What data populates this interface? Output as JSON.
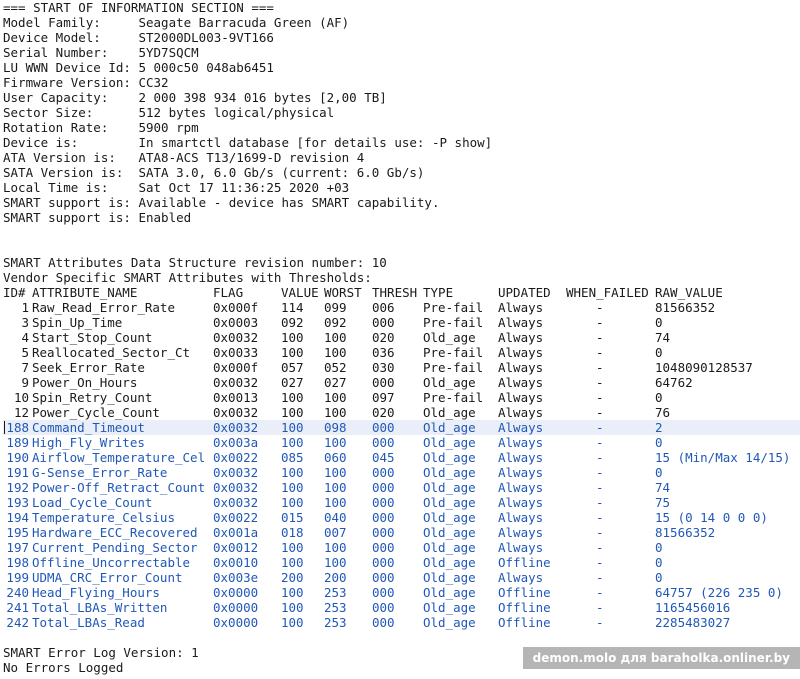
{
  "colors": {
    "text": "#1a1a1a",
    "highlight_text": "#2158b7",
    "background": "#ffffff"
  },
  "info": {
    "header": "=== START OF INFORMATION SECTION ===",
    "lines": [
      "Model Family:     Seagate Barracuda Green (AF)",
      "Device Model:     ST2000DL003-9VT166",
      "Serial Number:    5YD7SQCM",
      "LU WWN Device Id: 5 000c50 048ab6451",
      "Firmware Version: CC32",
      "User Capacity:    2 000 398 934 016 bytes [2,00 TB]",
      "Sector Size:      512 bytes logical/physical",
      "Rotation Rate:    5900 rpm",
      "Device is:        In smartctl database [for details use: -P show]",
      "ATA Version is:   ATA8-ACS T13/1699-D revision 4",
      "SATA Version is:  SATA 3.0, 6.0 Gb/s (current: 6.0 Gb/s)",
      "Local Time is:    Sat Oct 17 11:36:25 2020 +03",
      "SMART support is: Available - device has SMART capability.",
      "SMART support is: Enabled"
    ]
  },
  "smart": {
    "revision_line": "SMART Attributes Data Structure revision number: 10",
    "vendor_line": "Vendor Specific SMART Attributes with Thresholds:",
    "header": {
      "id": "ID#",
      "name": "ATTRIBUTE_NAME",
      "flag": "FLAG",
      "value": "VALUE",
      "worst": "WORST",
      "thresh": "THRESH",
      "type": "TYPE",
      "updated": "UPDATED",
      "when_failed": "WHEN_FAILED",
      "raw": "RAW_VALUE"
    },
    "rows": [
      {
        "id": "1",
        "name": "Raw_Read_Error_Rate",
        "flag": "0x000f",
        "value": "114",
        "worst": "099",
        "thresh": "006",
        "type": "Pre-fail",
        "updated": "Always",
        "when_failed": "-",
        "raw": "81566352"
      },
      {
        "id": "3",
        "name": "Spin_Up_Time",
        "flag": "0x0003",
        "value": "092",
        "worst": "092",
        "thresh": "000",
        "type": "Pre-fail",
        "updated": "Always",
        "when_failed": "-",
        "raw": "0"
      },
      {
        "id": "4",
        "name": "Start_Stop_Count",
        "flag": "0x0032",
        "value": "100",
        "worst": "100",
        "thresh": "020",
        "type": "Old_age",
        "updated": "Always",
        "when_failed": "-",
        "raw": "74"
      },
      {
        "id": "5",
        "name": "Reallocated_Sector_Ct",
        "flag": "0x0033",
        "value": "100",
        "worst": "100",
        "thresh": "036",
        "type": "Pre-fail",
        "updated": "Always",
        "when_failed": "-",
        "raw": "0"
      },
      {
        "id": "7",
        "name": "Seek_Error_Rate",
        "flag": "0x000f",
        "value": "057",
        "worst": "052",
        "thresh": "030",
        "type": "Pre-fail",
        "updated": "Always",
        "when_failed": "-",
        "raw": "1048090128537"
      },
      {
        "id": "9",
        "name": "Power_On_Hours",
        "flag": "0x0032",
        "value": "027",
        "worst": "027",
        "thresh": "000",
        "type": "Old_age",
        "updated": "Always",
        "when_failed": "-",
        "raw": "64762"
      },
      {
        "id": "10",
        "name": "Spin_Retry_Count",
        "flag": "0x0013",
        "value": "100",
        "worst": "100",
        "thresh": "097",
        "type": "Pre-fail",
        "updated": "Always",
        "when_failed": "-",
        "raw": "0"
      },
      {
        "id": "12",
        "name": "Power_Cycle_Count",
        "flag": "0x0032",
        "value": "100",
        "worst": "100",
        "thresh": "020",
        "type": "Old_age",
        "updated": "Always",
        "when_failed": "-",
        "raw": "76"
      },
      {
        "id": "188",
        "name": "Command_Timeout",
        "flag": "0x0032",
        "value": "100",
        "worst": "098",
        "thresh": "000",
        "type": "Old_age",
        "updated": "Always",
        "when_failed": "-",
        "raw": "2"
      },
      {
        "id": "189",
        "name": "High_Fly_Writes",
        "flag": "0x003a",
        "value": "100",
        "worst": "100",
        "thresh": "000",
        "type": "Old_age",
        "updated": "Always",
        "when_failed": "-",
        "raw": "0"
      },
      {
        "id": "190",
        "name": "Airflow_Temperature_Cel",
        "flag": "0x0022",
        "value": "085",
        "worst": "060",
        "thresh": "045",
        "type": "Old_age",
        "updated": "Always",
        "when_failed": "-",
        "raw": "15 (Min/Max 14/15)"
      },
      {
        "id": "191",
        "name": "G-Sense_Error_Rate",
        "flag": "0x0032",
        "value": "100",
        "worst": "100",
        "thresh": "000",
        "type": "Old_age",
        "updated": "Always",
        "when_failed": "-",
        "raw": "0"
      },
      {
        "id": "192",
        "name": "Power-Off_Retract_Count",
        "flag": "0x0032",
        "value": "100",
        "worst": "100",
        "thresh": "000",
        "type": "Old_age",
        "updated": "Always",
        "when_failed": "-",
        "raw": "74"
      },
      {
        "id": "193",
        "name": "Load_Cycle_Count",
        "flag": "0x0032",
        "value": "100",
        "worst": "100",
        "thresh": "000",
        "type": "Old_age",
        "updated": "Always",
        "when_failed": "-",
        "raw": "75"
      },
      {
        "id": "194",
        "name": "Temperature_Celsius",
        "flag": "0x0022",
        "value": "015",
        "worst": "040",
        "thresh": "000",
        "type": "Old_age",
        "updated": "Always",
        "when_failed": "-",
        "raw": "15 (0 14 0 0 0)"
      },
      {
        "id": "195",
        "name": "Hardware_ECC_Recovered",
        "flag": "0x001a",
        "value": "018",
        "worst": "007",
        "thresh": "000",
        "type": "Old_age",
        "updated": "Always",
        "when_failed": "-",
        "raw": "81566352"
      },
      {
        "id": "197",
        "name": "Current_Pending_Sector",
        "flag": "0x0012",
        "value": "100",
        "worst": "100",
        "thresh": "000",
        "type": "Old_age",
        "updated": "Always",
        "when_failed": "-",
        "raw": "0"
      },
      {
        "id": "198",
        "name": "Offline_Uncorrectable",
        "flag": "0x0010",
        "value": "100",
        "worst": "100",
        "thresh": "000",
        "type": "Old_age",
        "updated": "Offline",
        "when_failed": "-",
        "raw": "0"
      },
      {
        "id": "199",
        "name": "UDMA_CRC_Error_Count",
        "flag": "0x003e",
        "value": "200",
        "worst": "200",
        "thresh": "000",
        "type": "Old_age",
        "updated": "Always",
        "when_failed": "-",
        "raw": "0"
      },
      {
        "id": "240",
        "name": "Head_Flying_Hours",
        "flag": "0x0000",
        "value": "100",
        "worst": "253",
        "thresh": "000",
        "type": "Old_age",
        "updated": "Offline",
        "when_failed": "-",
        "raw": "64757 (226 235 0)"
      },
      {
        "id": "241",
        "name": "Total_LBAs_Written",
        "flag": "0x0000",
        "value": "100",
        "worst": "253",
        "thresh": "000",
        "type": "Old_age",
        "updated": "Offline",
        "when_failed": "-",
        "raw": "1165456016"
      },
      {
        "id": "242",
        "name": "Total_LBAs_Read",
        "flag": "0x0000",
        "value": "100",
        "worst": "253",
        "thresh": "000",
        "type": "Old_age",
        "updated": "Offline",
        "when_failed": "-",
        "raw": "2285483027"
      }
    ]
  },
  "error_log": {
    "version_line": "SMART Error Log Version: 1",
    "status_line": "No Errors Logged"
  },
  "watermark": "demon.molo для baraholka.onliner.by"
}
